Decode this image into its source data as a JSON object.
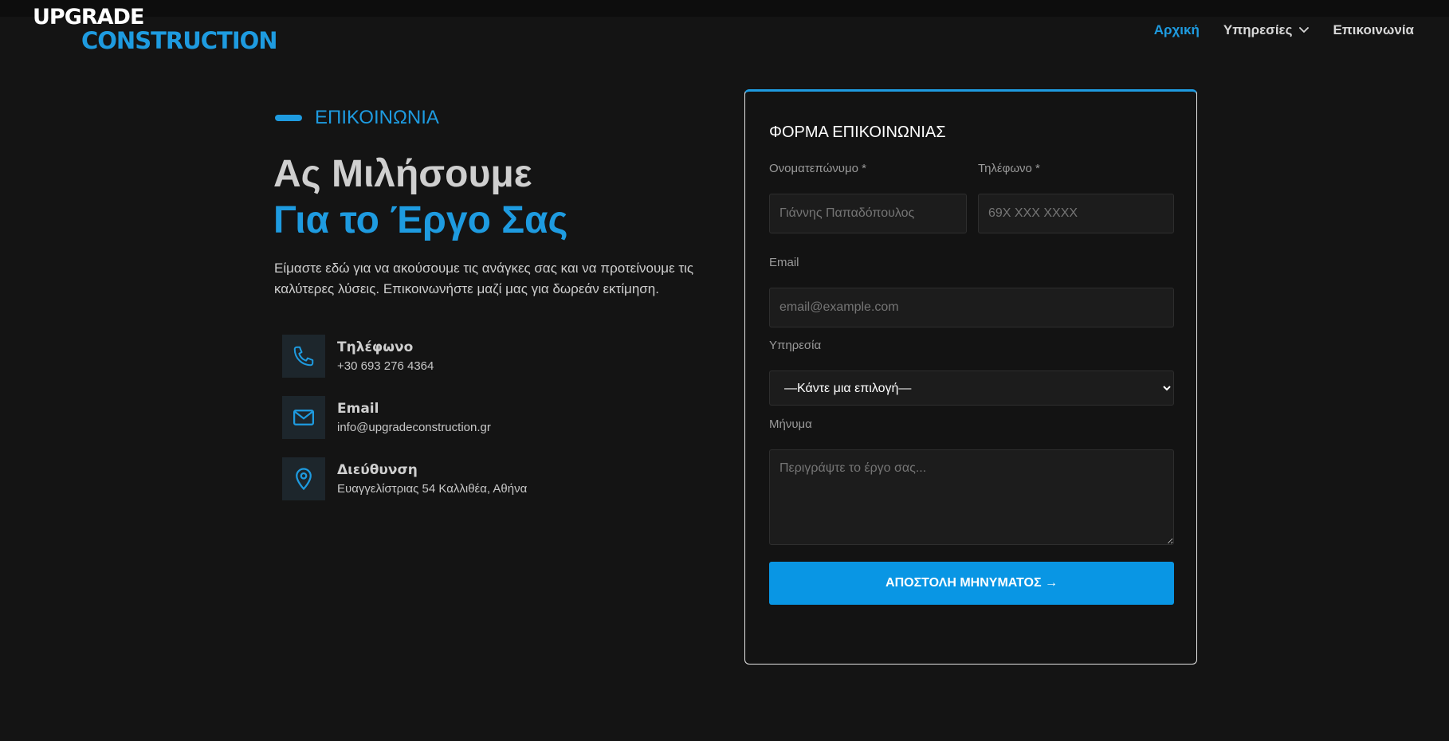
{
  "header": {
    "logo_line1": "UPGRADE",
    "logo_line2": "CONSTRUCTION",
    "nav": [
      {
        "label": "Αρχική",
        "active": true
      },
      {
        "label": "Υπηρεσίες",
        "has_dropdown": true
      },
      {
        "label": "Επικοινωνία"
      }
    ]
  },
  "hero": {
    "eyebrow": "ΕΠΙΚΟΙΝΩΝΙΑ",
    "title_line1": "Ας Μιλήσουμε",
    "title_line2": "Για το Έργο Σας",
    "intro": "Είμαστε εδώ για να ακούσουμε τις ανάγκες σας και να προτείνουμε τις καλύτερες λύσεις. Επικοινωνήστε μαζί μας για δωρεάν εκτίμηση."
  },
  "contact": [
    {
      "icon": "phone-icon",
      "title": "Τηλέφωνο",
      "value": "+30 693 276 4364"
    },
    {
      "icon": "envelope-icon",
      "title": "Email",
      "value": "info@upgradeconstruction.gr"
    },
    {
      "icon": "location-pin-icon",
      "title": "Διεύθυνση",
      "value": "Ευαγγελίστριας 54 Καλλιθέα, Αθήνα"
    }
  ],
  "form": {
    "title": "ΦΟΡΜΑ ΕΠΙΚΟΙΝΩΝΙΑΣ",
    "name": {
      "label": "Ονοματεπώνυμο *",
      "placeholder": "Γιάννης Παπαδόπουλος",
      "value": ""
    },
    "phone": {
      "label": "Τηλέφωνο *",
      "placeholder": "69X XXX XXXX",
      "value": ""
    },
    "email": {
      "label": "Email",
      "placeholder": "email@example.com",
      "value": ""
    },
    "service": {
      "label": "Υπηρεσία",
      "selected": "—Κάντε μια επιλογή—"
    },
    "message": {
      "label": "Μήνυμα",
      "placeholder": "Περιγράψτε το έργο σας...",
      "value": ""
    },
    "submit_label": "ΑΠΟΣΤΟΛΗ ΜΗΝΥΜΑΤΟΣ →"
  },
  "colors": {
    "accent": "#1e9be0",
    "button": "#0996e4",
    "background": "#141414"
  }
}
